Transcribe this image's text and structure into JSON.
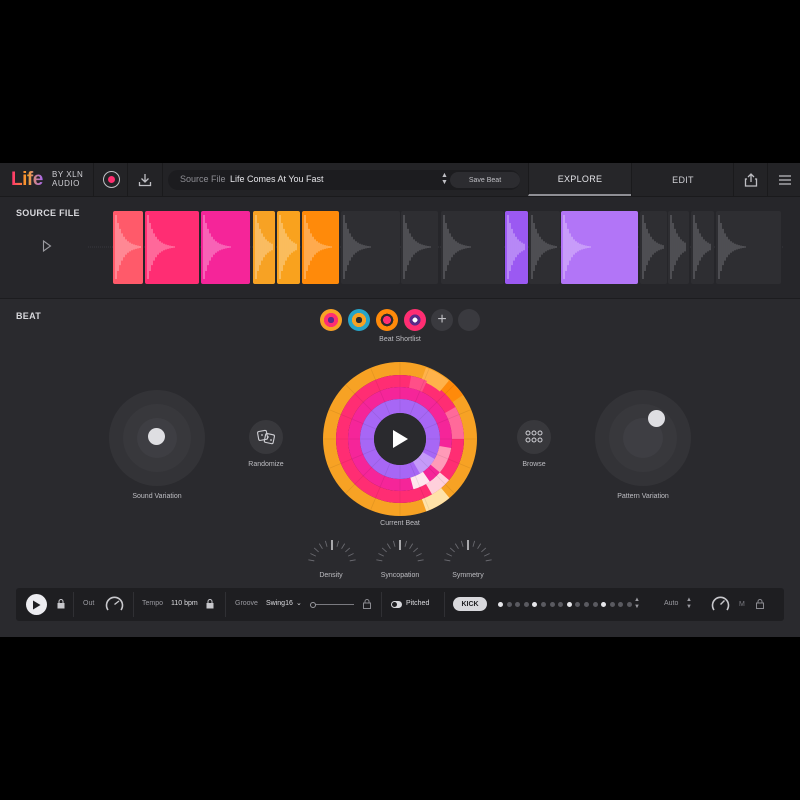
{
  "header": {
    "logo_title": "Life",
    "logo_by": "BY XLN",
    "logo_audio": "AUDIO",
    "source_file_label": "Source File",
    "source_file_value": "Life Comes At You Fast",
    "save_beat_label": "Save Beat",
    "tabs": [
      {
        "label": "EXPLORE",
        "active": true
      },
      {
        "label": "EDIT",
        "active": false
      }
    ]
  },
  "source_section": {
    "title": "SOURCE FILE",
    "segments": [
      {
        "color": "#ff5a6a"
      },
      {
        "color": "#ff2d73"
      },
      {
        "color": "#f52599"
      },
      {
        "color": "#f7a224"
      },
      {
        "color": "#f9a21e"
      },
      {
        "color": "#ff8a0a"
      },
      {
        "color": "#2e2e32"
      },
      {
        "color": "#2e2e32"
      },
      {
        "color": "#2e2e32"
      },
      {
        "color": "#9b59f2"
      },
      {
        "color": "#2e2e32"
      },
      {
        "color": "#b275f7"
      },
      {
        "color": "#2e2e32"
      },
      {
        "color": "#2e2e32"
      },
      {
        "color": "#2e2e32"
      },
      {
        "color": "#2e2e32"
      }
    ]
  },
  "beat_section": {
    "title": "BEAT",
    "shortlist_label": "Beat Shortlist",
    "sound_variation_label": "Sound Variation",
    "randomize_label": "Randomize",
    "current_beat_label": "Current Beat",
    "browse_label": "Browse",
    "pattern_variation_label": "Pattern Variation",
    "knobs": [
      {
        "label": "Density"
      },
      {
        "label": "Syncopation"
      },
      {
        "label": "Symmetry"
      }
    ]
  },
  "transport": {
    "out_label": "Out",
    "tempo_label": "Tempo",
    "tempo_value": "110 bpm",
    "groove_label": "Groove",
    "groove_value": "Swing16",
    "pitched_label": "Pitched",
    "instrument": "KICK",
    "steps": [
      1,
      0,
      0,
      0,
      1,
      0,
      0,
      0,
      1,
      0,
      0,
      0,
      1,
      0,
      0,
      0
    ],
    "auto_label": "Auto",
    "m_label": "M"
  },
  "colors": {
    "accent_pink": "#ff2d73",
    "accent_orange": "#ff9a0a",
    "accent_purple": "#a767f5",
    "background": "#2a2a2e"
  }
}
